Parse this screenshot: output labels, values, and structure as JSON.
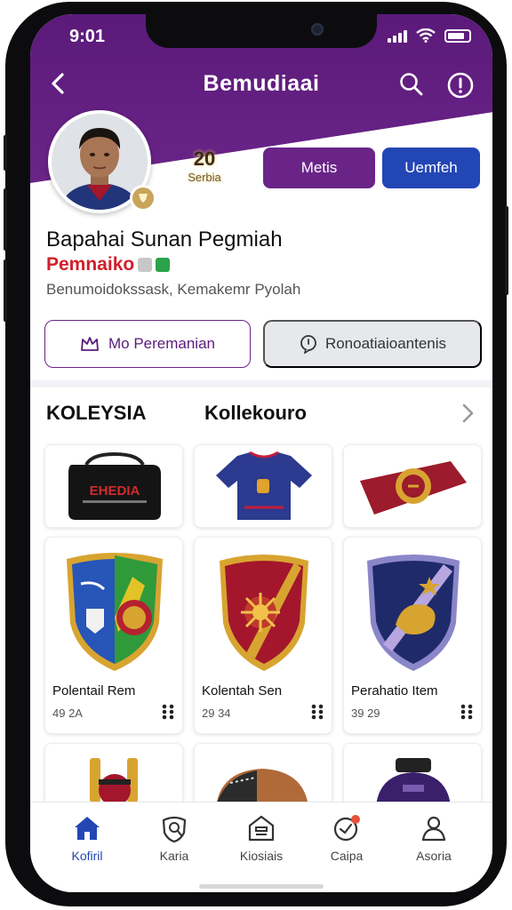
{
  "status": {
    "time": "9:01"
  },
  "nav": {
    "title": "Bemudiaai"
  },
  "profile": {
    "stat_value": "20",
    "stat_label": "Serbia",
    "button_primary": "Metis",
    "button_secondary": "Uemfeh",
    "name": "Bapahai Sunan Pegmiah",
    "role": "Pemnaiko",
    "bio": "Benumoidokssask, Kemakemr Pyolah"
  },
  "actions": {
    "primary": "Mo Peremanian",
    "secondary": "Ronoatiaioantenis"
  },
  "section": {
    "left": "KOLEYSIA",
    "right": "Kollekouro"
  },
  "items": [
    {
      "name": "",
      "count": "",
      "art": "bag",
      "art_text": "EHEDIA"
    },
    {
      "name": "",
      "count": "",
      "art": "jersey"
    },
    {
      "name": "",
      "count": "",
      "art": "scarf"
    },
    {
      "name": "Polentail Rem",
      "count": "49 2A",
      "art": "shield-blue"
    },
    {
      "name": "Kolentah Sen",
      "count": "29 34",
      "art": "shield-red"
    },
    {
      "name": "Perahatio Item",
      "count": "39 29",
      "art": "shield-navy"
    },
    {
      "name": "",
      "count": "",
      "art": "trophy"
    },
    {
      "name": "",
      "count": "",
      "art": "ball"
    },
    {
      "name": "",
      "count": "",
      "art": "kit"
    }
  ],
  "tabs": [
    {
      "label": "Kofiril",
      "icon": "home-icon",
      "active": true
    },
    {
      "label": "Karia",
      "icon": "badge-icon",
      "active": false
    },
    {
      "label": "Kiosiais",
      "icon": "store-icon",
      "active": false
    },
    {
      "label": "Caipa",
      "icon": "chat-icon",
      "active": false
    },
    {
      "label": "Asoria",
      "icon": "profile-icon",
      "active": false
    }
  ],
  "colors": {
    "brand": "#6a2488",
    "accent": "#2346b5",
    "role": "#d11f2a"
  }
}
